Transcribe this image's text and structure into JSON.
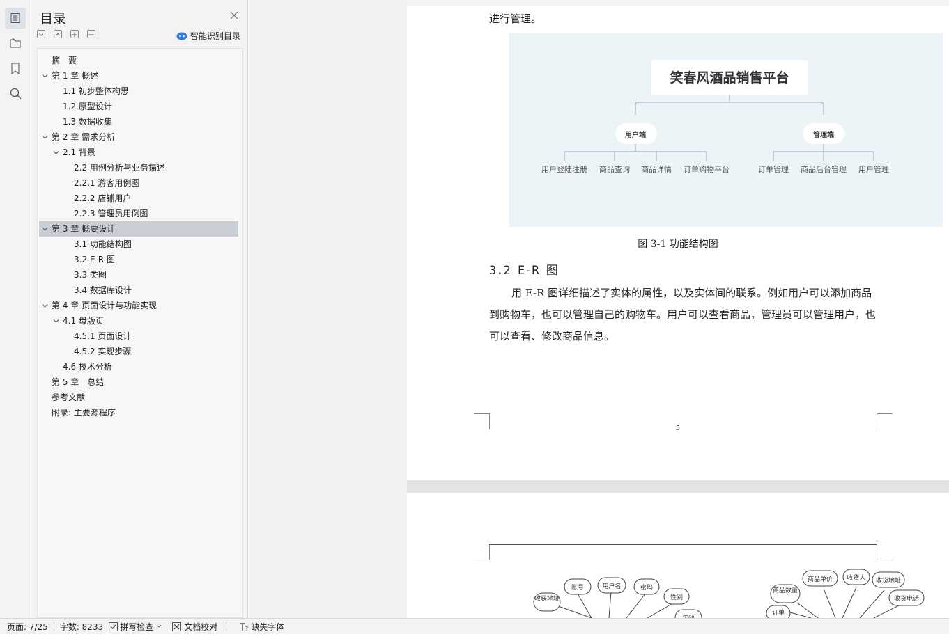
{
  "toc": {
    "title": "目录",
    "smart_label": "智能识别目录",
    "items": [
      {
        "label": "摘　要",
        "level": 0,
        "chevron": false,
        "selected": false
      },
      {
        "label": "第 1 章  概述",
        "level": 0,
        "chevron": true,
        "selected": false
      },
      {
        "label": "1.1 初步整体构思",
        "level": 1,
        "chevron": false,
        "selected": false
      },
      {
        "label": "1.2 原型设计",
        "level": 1,
        "chevron": false,
        "selected": false
      },
      {
        "label": "1.3 数据收集",
        "level": 1,
        "chevron": false,
        "selected": false
      },
      {
        "label": "第 2 章  需求分析",
        "level": 0,
        "chevron": true,
        "selected": false
      },
      {
        "label": "2.1 背景",
        "level": 1,
        "chevron": true,
        "selected": false
      },
      {
        "label": "2.2 用例分析与业务描述",
        "level": 2,
        "chevron": false,
        "selected": false
      },
      {
        "label": "2.2.1 游客用例图",
        "level": 2,
        "chevron": false,
        "selected": false
      },
      {
        "label": "2.2.2  店铺用户",
        "level": 2,
        "chevron": false,
        "selected": false
      },
      {
        "label": "2.2.3 管理员用例图",
        "level": 2,
        "chevron": false,
        "selected": false
      },
      {
        "label": "第 3 章  概要设计",
        "level": 0,
        "chevron": true,
        "selected": true
      },
      {
        "label": "3.1 功能结构图",
        "level": 2,
        "chevron": false,
        "selected": false
      },
      {
        "label": "3.2 E-R 图",
        "level": 2,
        "chevron": false,
        "selected": false
      },
      {
        "label": "3.3  类图",
        "level": 2,
        "chevron": false,
        "selected": false
      },
      {
        "label": "3.4 数据库设计",
        "level": 2,
        "chevron": false,
        "selected": false
      },
      {
        "label": "第 4 章  页面设计与功能实现",
        "level": 0,
        "chevron": true,
        "selected": false
      },
      {
        "label": "4.1 母版页",
        "level": 1,
        "chevron": true,
        "selected": false
      },
      {
        "label": "4.5.1 页面设计",
        "level": 2,
        "chevron": false,
        "selected": false
      },
      {
        "label": "4.5.2 实现步骤",
        "level": 2,
        "chevron": false,
        "selected": false
      },
      {
        "label": "4.6 技术分析",
        "level": 1,
        "chevron": false,
        "selected": false
      },
      {
        "label": "第 5 章　总结",
        "level": 0,
        "chevron": false,
        "selected": false
      },
      {
        "label": "参考文献",
        "level": 0,
        "chevron": false,
        "selected": false
      },
      {
        "label": "附录: 主要源程序",
        "level": 0,
        "chevron": false,
        "selected": false
      }
    ]
  },
  "doc": {
    "top_line": "进行管理。",
    "figure": {
      "root": "笑春风酒品销售平台",
      "user_node": "用户端",
      "admin_node": "管理端",
      "user_leaves": [
        "用户登陆注册",
        "商品查询",
        "商品详情",
        "订单购物平台"
      ],
      "admin_leaves": [
        "订单管理",
        "商品后台管理",
        "用户管理"
      ]
    },
    "caption": "图 3-1 功能结构图",
    "heading": "3.2 E-R 图",
    "paragraph": "用 E-R 图详细描述了实体的属性，以及实体间的联系。例如用户可以添加商品到购物车，也可以管理自己的购物车。用户可以查看商品，管理员可以管理用户，也可以查看、修改商品信息。",
    "page_number": "5",
    "er_left": [
      "收获地址",
      "账号",
      "用户名",
      "密码",
      "性别",
      "年龄"
    ],
    "er_right": [
      "商品数量",
      "商品单价",
      "收货人",
      "收货地址",
      "收货电话",
      "订单"
    ]
  },
  "status": {
    "page": "页面: 7/25",
    "words": "字数: 8233",
    "spell": "拼写检查",
    "proof": "文档校对",
    "missing_font": "缺失字体"
  },
  "colors": {
    "accent": "#2f7be0",
    "selection": "#c9ced6",
    "figure_bg": "#edf4f8"
  }
}
